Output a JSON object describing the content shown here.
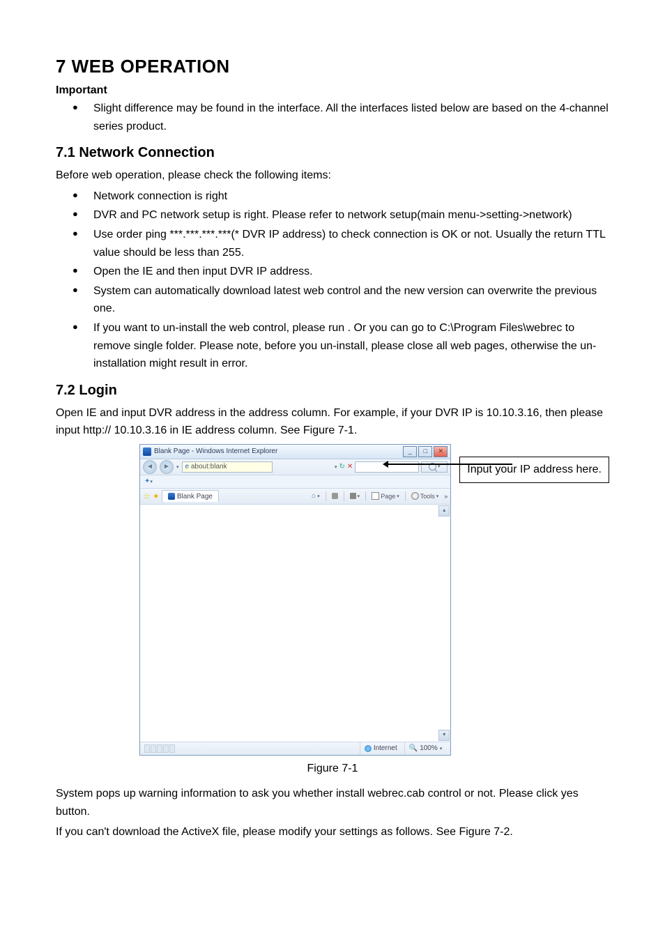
{
  "heading1": "7  WEB OPERATION",
  "important_label": "Important",
  "bullets_top": [
    "Slight difference may be found in the interface. All the interfaces listed below are based on the 4-channel series product."
  ],
  "heading2_1": "7.1  Network Connection",
  "para_nc": "Before web operation, please check the following items:",
  "bullets_nc": [
    "Network connection is right",
    "DVR and PC network setup is right. Please refer to network setup(main menu->setting->network)",
    "Use order ping ***.***.***.***(* DVR IP address) to check connection is OK or not. Usually the return TTL value should be less than 255.",
    "Open the IE and then input DVR IP address.",
    "System can automatically download latest web control and the new version can overwrite the previous one.",
    "If you want to un-install the web control, please run                                          . Or you can go to C:\\Program Files\\webrec to remove single folder. Please note, before you un-install, please close all web pages, otherwise the un-installation might result in error."
  ],
  "heading2_2": "7.2  Login",
  "para_login": "Open IE and input DVR address in the address column. For example, if your DVR IP is 10.10.3.16, then please input http:// 10.10.3.16 in IE address column. See Figure 7-1.",
  "ie_window": {
    "title": "Blank Page - Windows Internet Explorer",
    "address_value": "about:blank",
    "tab_label": "Blank Page",
    "tool_home": "",
    "tool_page": "Page",
    "tool_tools": "Tools",
    "status_zone": "Internet",
    "status_zoom": "100%"
  },
  "callout_text": "Input your IP address here.",
  "figure_caption": "Figure 7-1",
  "para_after1": "System pops up warning information to ask you whether install webrec.cab control or not. Please click yes button.",
  "para_after2": "If you can't download the ActiveX file, please modify your settings as follows. See Figure 7-2."
}
